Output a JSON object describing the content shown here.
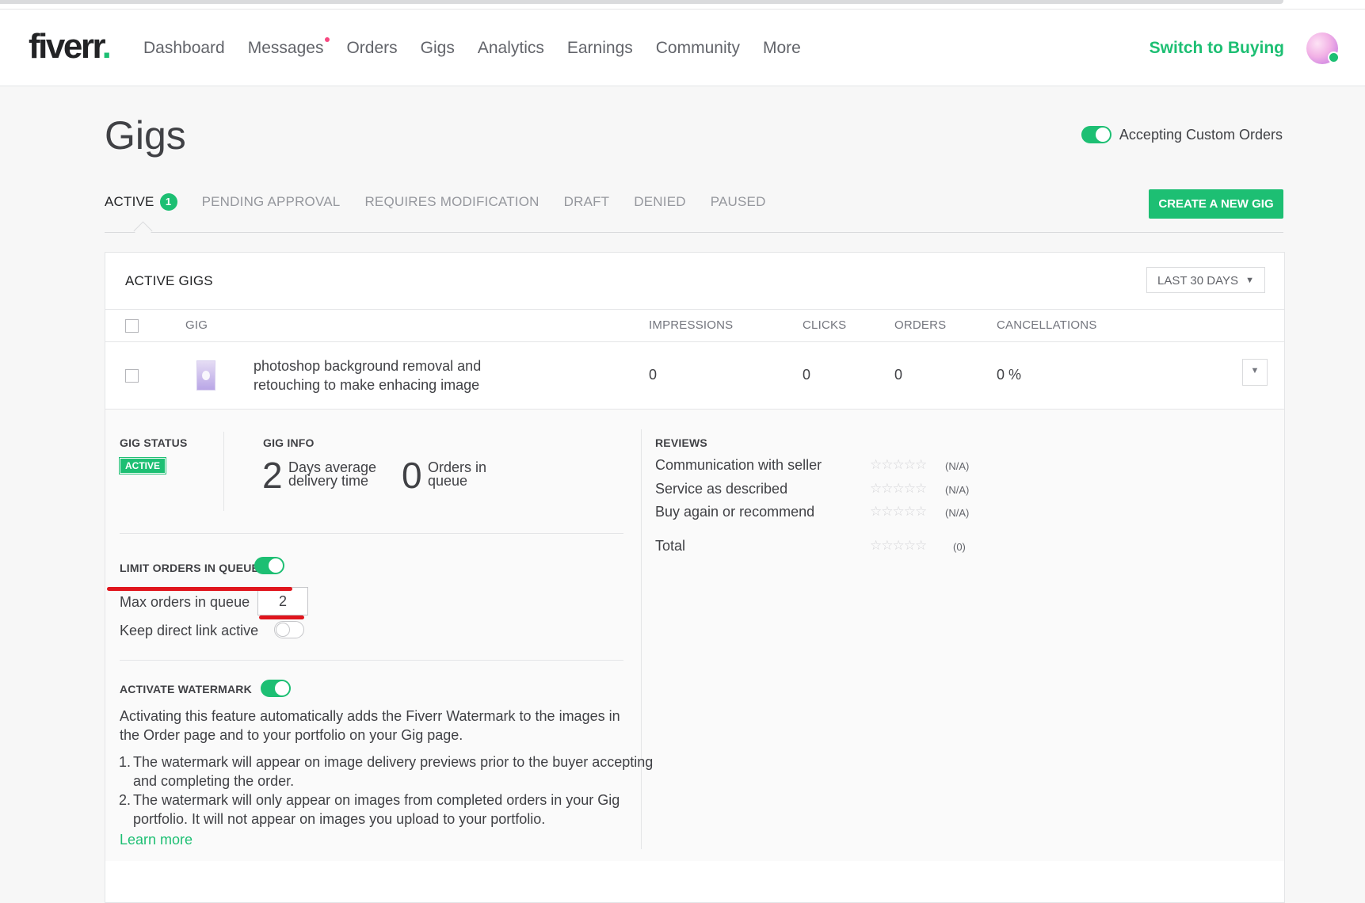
{
  "header": {
    "logo": "fiverr",
    "logo_dot": ".",
    "nav": [
      {
        "label": "Dashboard"
      },
      {
        "label": "Messages",
        "has_notification": true
      },
      {
        "label": "Orders"
      },
      {
        "label": "Gigs"
      },
      {
        "label": "Analytics"
      },
      {
        "label": "Earnings"
      },
      {
        "label": "Community"
      },
      {
        "label": "More"
      }
    ],
    "switch_label": "Switch to Buying"
  },
  "page": {
    "title": "Gigs",
    "custom_orders_label": "Accepting Custom Orders",
    "custom_orders_on": true
  },
  "tabs": [
    {
      "label": "ACTIVE",
      "count": "1",
      "active": true
    },
    {
      "label": "PENDING APPROVAL"
    },
    {
      "label": "REQUIRES MODIFICATION"
    },
    {
      "label": "DRAFT"
    },
    {
      "label": "DENIED"
    },
    {
      "label": "PAUSED"
    }
  ],
  "create_button": "CREATE A NEW GIG",
  "panel": {
    "title": "ACTIVE GIGS",
    "period": "LAST 30 DAYS",
    "columns": {
      "gig": "GIG",
      "impressions": "IMPRESSIONS",
      "clicks": "CLICKS",
      "orders": "ORDERS",
      "cancellations": "CANCELLATIONS"
    },
    "rows": [
      {
        "title": "photoshop background removal and retouching to make enhacing image",
        "impressions": "0",
        "clicks": "0",
        "orders": "0",
        "cancellations": "0 %"
      }
    ]
  },
  "details": {
    "status_label": "GIG STATUS",
    "status_value": "ACTIVE",
    "info_label": "GIG INFO",
    "delivery_days": "2",
    "delivery_desc_1": "Days average",
    "delivery_desc_2": "delivery time",
    "queue_count": "0",
    "queue_desc_1": "Orders in",
    "queue_desc_2": "queue",
    "limit_label": "LIMIT ORDERS IN QUEUE",
    "limit_on": true,
    "max_orders_label": "Max orders in queue",
    "max_orders_value": "2",
    "direct_link_label": "Keep direct link active",
    "direct_link_on": false,
    "watermark_label": "ACTIVATE WATERMARK",
    "watermark_on": true,
    "watermark_desc": "Activating this feature automatically adds the Fiverr Watermark to the images in the Order page and to your portfolio on your Gig page.",
    "watermark_points": [
      {
        "num": "1.",
        "text": "The watermark will appear on image delivery previews prior to the buyer accepting and completing the order."
      },
      {
        "num": "2.",
        "text": "The watermark will only appear on images from completed orders in your Gig portfolio. It will not appear on images you upload to your portfolio."
      }
    ],
    "learn_more": "Learn more",
    "reviews_label": "REVIEWS",
    "reviews": [
      {
        "label": "Communication with seller",
        "value": "(N/A)"
      },
      {
        "label": "Service as described",
        "value": "(N/A)"
      },
      {
        "label": "Buy again or recommend",
        "value": "(N/A)"
      }
    ],
    "total_label": "Total",
    "total_value": "(0)",
    "stars": "☆☆☆☆☆"
  },
  "colors": {
    "accent": "#1dbf73",
    "annotation_red": "#e0151d",
    "notification": "#f74780"
  }
}
